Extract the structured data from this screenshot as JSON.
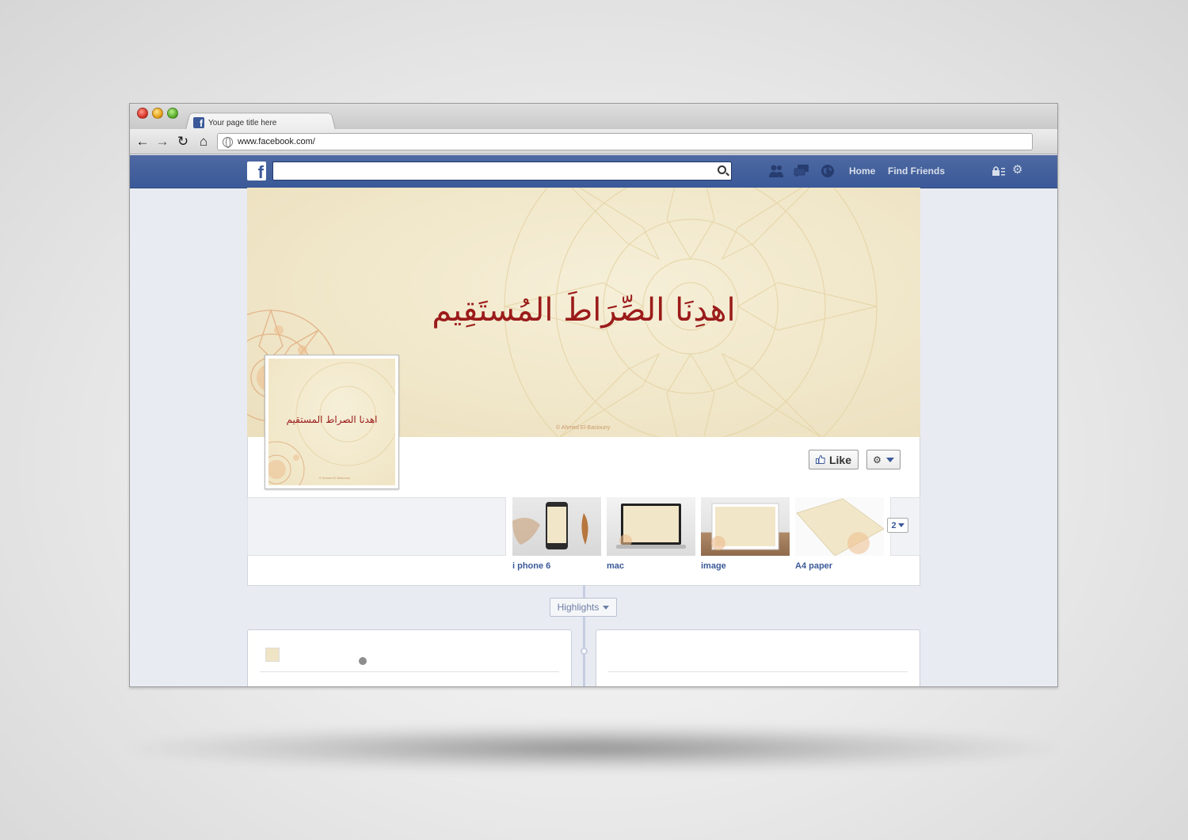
{
  "browser": {
    "tab_title": "Your page title here",
    "url": "www.facebook.com/"
  },
  "fb": {
    "logo_letter": "f",
    "search_placeholder": "",
    "nav_home": "Home",
    "nav_find_friends": "Find Friends"
  },
  "cover": {
    "title": "اهدِنَا الصِّرَاطَ المُستَقِيم",
    "credit": "© Ahmed El-Basiouny"
  },
  "profile": {
    "title": "اهدنا الصراط المستقيم",
    "credit": "© Ahmed El-Basiouny"
  },
  "actions": {
    "like_label": "Like"
  },
  "apps": [
    {
      "label": "i phone 6"
    },
    {
      "label": "mac"
    },
    {
      "label": "image"
    },
    {
      "label": "A4 paper"
    }
  ],
  "more_count": "2",
  "timeline": {
    "highlights_label": "Highlights"
  },
  "colors": {
    "fb_blue": "#3b5998",
    "cover_text": "#9b1b1b",
    "cover_bg": "#f0e6c8"
  }
}
